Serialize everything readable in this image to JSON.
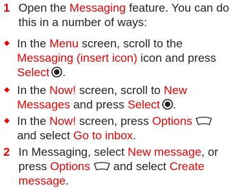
{
  "step1": {
    "number": "1",
    "line1_a": "Open the ",
    "line1_hl": "Messaging",
    "line1_b": " feature. You can do",
    "line2": "this in a number of ways:"
  },
  "bullets": [
    {
      "p1": "In the ",
      "h1": "Menu",
      "p2": " screen, scroll to the",
      "h2": "Messaging (insert icon)",
      "p3": " icon and press",
      "h3": "Select",
      "icon": "select-button-icon"
    },
    {
      "p1": "In the ",
      "h1": "Now!",
      "p2": " screen, scroll to ",
      "h2": "New",
      "h2b": "Messages",
      "p3": " and press ",
      "h3": "Select",
      "icon": "select-button-icon"
    },
    {
      "p1": "In the ",
      "h1": "Now!",
      "p2": " screen, press ",
      "h2": "Options",
      "icon": "options-softkey-icon",
      "p3": "and select ",
      "h3": "Go to inbox",
      "p4": "."
    }
  ],
  "step2": {
    "number": "2",
    "p1": "In Messaging, select ",
    "h1": "New message",
    "p2": ", or",
    "p3": "press ",
    "h2": "Options",
    "icon": "options-softkey-icon",
    "p4": " and select ",
    "h3": "Create",
    "h3b": "message",
    "p5": "."
  },
  "colors": {
    "accent": "#e60000",
    "text": "#222222"
  }
}
